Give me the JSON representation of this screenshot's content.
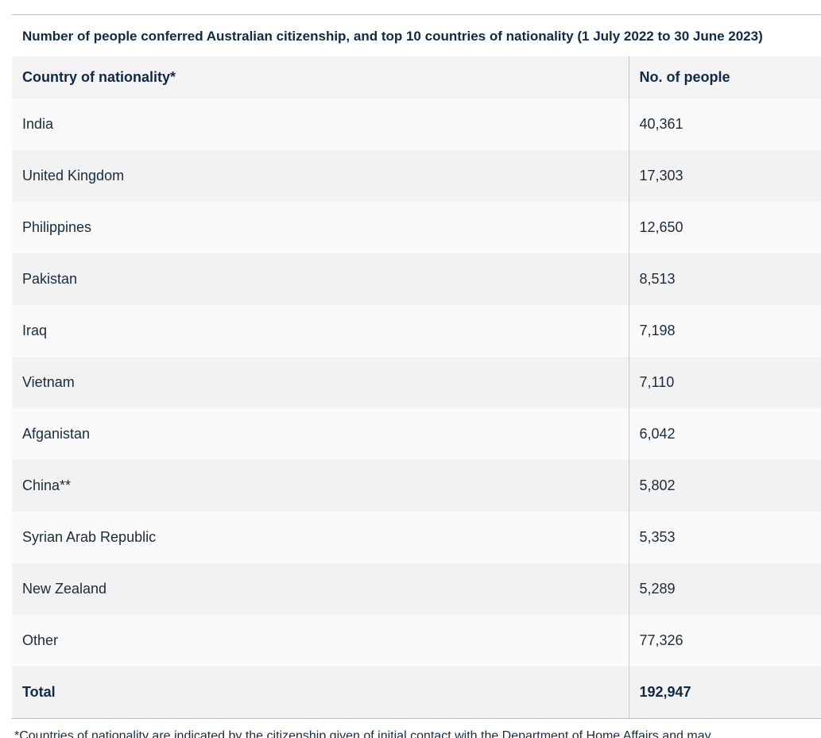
{
  "table": {
    "caption": "Number of people conferred Australian citizenship, and top 10 countries of nationality (1 July 2022 to 30 June 2023)",
    "headers": [
      "Country of nationality*",
      "No. of people"
    ],
    "rows": [
      {
        "country": "India",
        "count": "40,361"
      },
      {
        "country": "United Kingdom",
        "count": "17,303"
      },
      {
        "country": "Philippines",
        "count": "12,650"
      },
      {
        "country": "Pakistan",
        "count": "8,513"
      },
      {
        "country": "Iraq",
        "count": "7,198"
      },
      {
        "country": "Vietnam",
        "count": "7,110"
      },
      {
        "country": "Afganistan",
        "count": "6,042"
      },
      {
        "country": "China**",
        "count": "5,802"
      },
      {
        "country": "Syrian Arab Republic",
        "count": "5,353"
      },
      {
        "country": "New Zealand",
        "count": "5,289"
      },
      {
        "country": "Other",
        "count": "77,326"
      }
    ],
    "total": {
      "label": "Total",
      "count": "192,947"
    }
  },
  "footnote": "*Countries of nationality are indicated by the citizenship given of initial contact with the Department of Home Affairs and may"
}
